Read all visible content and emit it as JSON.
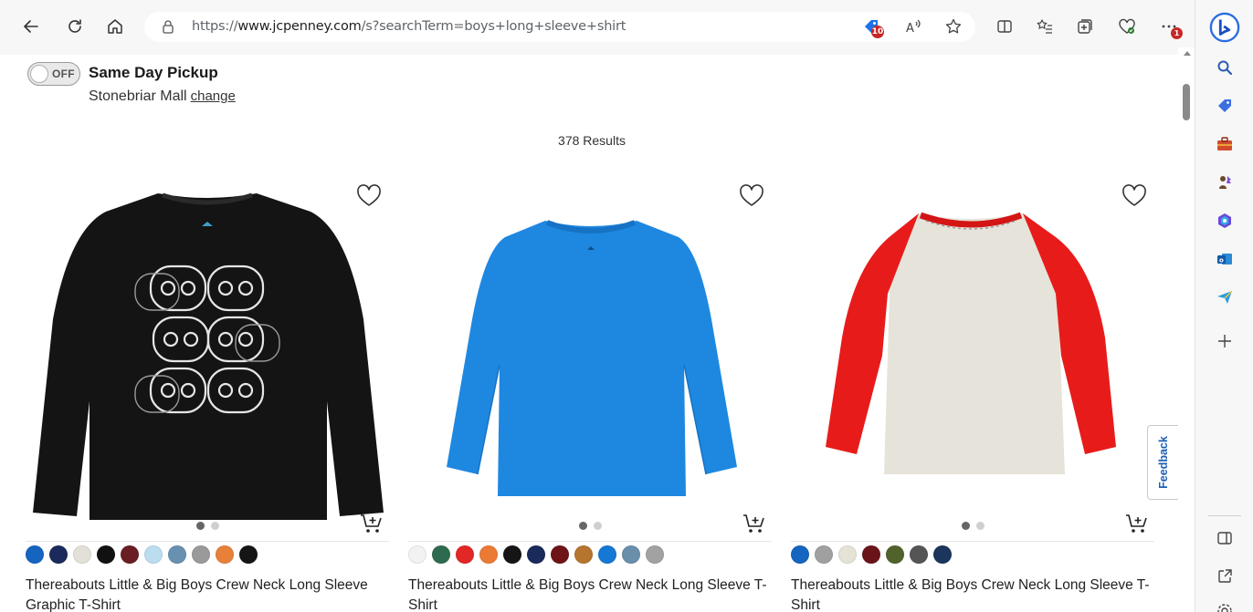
{
  "browser": {
    "url_prefix": "https://",
    "url_domain": "www.jcpenney.com",
    "url_path": "/s?searchTerm=boys+long+sleeve+shirt",
    "extension_badge": "10",
    "menu_badge": "1"
  },
  "pickup": {
    "toggle_label": "OFF",
    "title": "Same Day Pickup",
    "store_name": "Stonebriar Mall",
    "change_link": "change"
  },
  "results_text": "378 Results",
  "feedback_label": "Feedback",
  "products": [
    {
      "name": "Thereabouts Little & Big Boys Crew Neck Long Sleeve Graphic T-Shirt",
      "image": "black-controller-graphic-tee",
      "swatches": [
        "#1565c0",
        "#1a2a5a",
        "#e3e0da",
        "#111111",
        "#6a1e24",
        "#bcdcf0",
        "#6890b0",
        "#9a9a9a",
        "#e8803a",
        "#151515"
      ]
    },
    {
      "name": "Thereabouts Little & Big Boys Crew Neck Long Sleeve T-Shirt",
      "image": "blue-long-sleeve-tee",
      "swatches": [
        "#f2f2f2",
        "#2e6b4e",
        "#e32626",
        "#ea7a34",
        "#151515",
        "#1a2a5a",
        "#6e1419",
        "#b5752f",
        "#1478d4",
        "#6a8fab",
        "#a2a2a2"
      ]
    },
    {
      "name": "Thereabouts Little & Big Boys Crew Neck Long Sleeve T-Shirt",
      "image": "red-raglan-tee",
      "swatches": [
        "#1565c0",
        "#a0a0a0",
        "#e5e3d6",
        "#6a1419",
        "#51622a",
        "#555555",
        "#1c355c"
      ]
    }
  ],
  "colors": {
    "accent": "#1c5fb3",
    "toolbar_bg": "#f7f7f7"
  }
}
